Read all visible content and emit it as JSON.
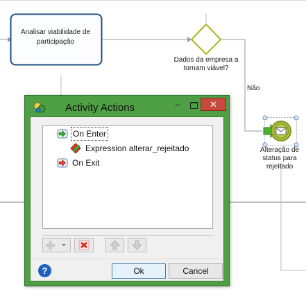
{
  "diagram": {
    "task_label": "Analisar viabilidade de participação",
    "gateway_label": "Dados da empresa a tornam viável?",
    "flow_label": "Não",
    "event_label": "Alteração de status para rejeitado"
  },
  "dialog": {
    "title": "Activity Actions",
    "tree": {
      "on_enter": "On Enter",
      "expression": "Expression alterar_rejeitado",
      "on_exit": "On Exit"
    },
    "help_glyph": "?",
    "ok_label": "Ok",
    "cancel_label": "Cancel",
    "close_glyph": "✕",
    "minimize_glyph": "–"
  },
  "icons": {
    "title": "activity-actions-icon",
    "enter": "enter-action-icon",
    "expression": "expression-icon",
    "exit": "exit-action-icon",
    "add": "add-icon",
    "delete": "delete-icon",
    "up": "move-up-icon",
    "down": "move-down-icon"
  },
  "colors": {
    "dialog_frame": "#4f9f45",
    "close_button": "#c74a3c",
    "gateway": "#a8b81a",
    "task_border": "#1c4f82",
    "event_fill": "#b6c94a"
  }
}
